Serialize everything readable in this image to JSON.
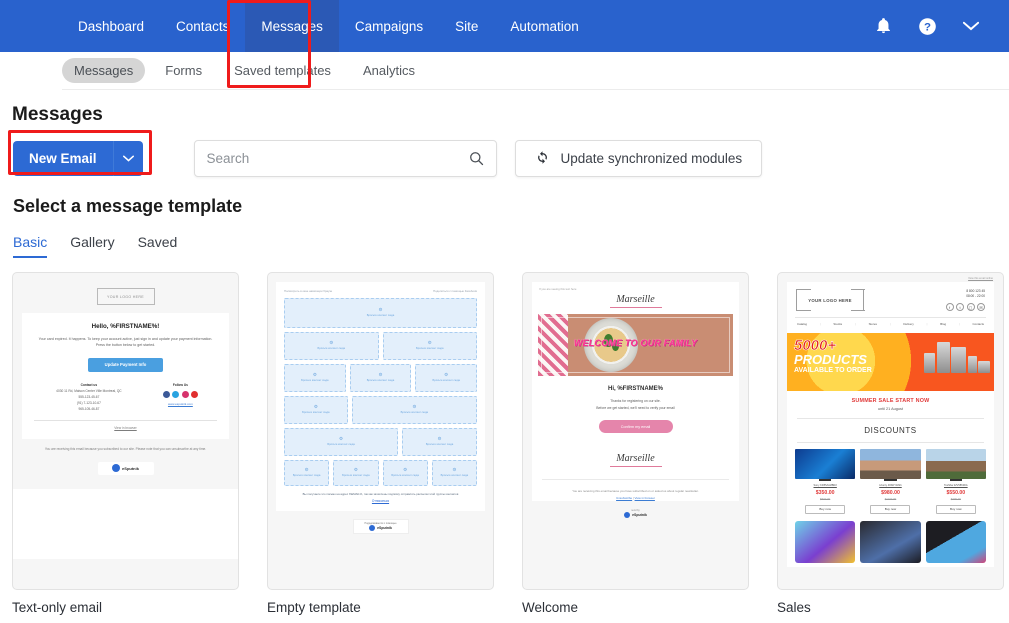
{
  "topnav": {
    "items": [
      {
        "label": "Dashboard",
        "active": false
      },
      {
        "label": "Contacts",
        "active": false
      },
      {
        "label": "Messages",
        "active": true
      },
      {
        "label": "Campaigns",
        "active": false
      },
      {
        "label": "Site",
        "active": false
      },
      {
        "label": "Automation",
        "active": false
      }
    ],
    "icons": [
      "bell-icon",
      "help-icon",
      "chevron-down-icon"
    ],
    "accent_color": "#2962cd",
    "active_color": "#2b59b5"
  },
  "subnav": {
    "items": [
      {
        "label": "Messages",
        "active": true
      },
      {
        "label": "Forms",
        "active": false
      },
      {
        "label": "Saved templates",
        "active": false
      },
      {
        "label": "Analytics",
        "active": false
      }
    ]
  },
  "annotations": {
    "color": "#ef1b1b",
    "boxes": [
      "messages-nav-highlight",
      "new-email-button-highlight"
    ]
  },
  "page": {
    "title": "Messages",
    "section_title": "Select a message template"
  },
  "toolbar": {
    "new_email_label": "New Email",
    "new_email_caret": "⌄",
    "search_placeholder": "Search",
    "search_value": "",
    "update_label": "Update synchronized modules",
    "button_color": "#2d6ad4"
  },
  "tabs": [
    {
      "label": "Basic",
      "active": true
    },
    {
      "label": "Gallery",
      "active": false
    },
    {
      "label": "Saved",
      "active": false
    }
  ],
  "templates": [
    {
      "label": "Text-only email",
      "preview": {
        "logo": "YOUR LOGO HERE",
        "heading": "Hello, %FIRSTNAME%!",
        "paragraph": "Your card expired. It happens. To keep your account active, just sign in and update your payment information. Press the button below to get started.",
        "button": "Update Payment Info",
        "contact_label": "Contact us",
        "contact_address": "4030 11 Rd, Maison Center Ville Montreal, QC",
        "contact_phones": [
          "555-123-45-67",
          "(91) 7-123-10-67",
          "965-105-46-87"
        ],
        "follow_label": "Follow Us",
        "follow_link": "www.esputnik.com",
        "view_in_browser": "View in browser",
        "footer": "You are receiving this email because you subscribed to our site. Please note that you can unsubscribe at any time.",
        "footer_link": "unsubscribe",
        "badge_pre": "send by",
        "badge": "eSputnik"
      }
    },
    {
      "label": "Empty template",
      "preview": {
        "top_left": "Посмотреть в окне навигации браузе",
        "top_right": "Поделиться с помощью Facebook",
        "dropzone_label": "Бросьте контент сюда",
        "rows": [
          [
            1
          ],
          [
            1,
            1
          ],
          [
            1,
            1,
            1
          ],
          [
            1,
            2
          ],
          [
            2,
            1
          ],
          [
            1,
            1,
            1,
            1
          ]
        ],
        "footer": "Вы получаете это письмо на адрес %EMAIL%, так как зачислены подписку отправлять рассылки этой группы контактов",
        "unsubscribe": "Отписаться",
        "badge_pre": "Поддерживается с помощью",
        "badge": "eSputnik"
      }
    },
    {
      "label": "Welcome",
      "preview": {
        "preheader": "If you are seeing this text here",
        "brand": "Marseille",
        "hero_text": "WELCOME TO OUR FAMILY",
        "heading": "Hi, %FIRSTNAME%",
        "paragraph_1": "Thanks for registering on our site.",
        "paragraph_2": "Before we get started, we'll need to verify your email",
        "button": "Confirm my email",
        "brand_footer": "Marseille",
        "footer": "You are receiving this email because you have subscribed on or asked us about regular newsletter.",
        "footer_links": [
          "Unsubscribe",
          "View in browser"
        ],
        "badge_pre": "send by",
        "badge": "eSputnik"
      }
    },
    {
      "label": "Sales",
      "preview": {
        "top_link": "View this email online",
        "logo": "YOUR LOGO HERE",
        "phone": "8 800 123 45",
        "hours": "08:00 - 22:00",
        "menu": [
          "Catalog",
          "Stocks",
          "Stores",
          "Delivery",
          "Blog",
          "Contacts"
        ],
        "banner_line_1": "5000+",
        "banner_line_2": "PRODUCTS",
        "banner_line_3": "AVAILABLE TO ORDER",
        "sale_title": "SUMMER SALE START NOW",
        "sale_until": "until 21 August",
        "discounts_title": "DISCOUNTS",
        "products": [
          {
            "name": "Sony KD55AG8BR2",
            "price": "$350.00",
            "old_price": "$500.00",
            "button": "Buy now"
          },
          {
            "name": "Liberty 49SDY1821",
            "price": "$980.00",
            "old_price": "$1100.00",
            "button": "Buy now"
          },
          {
            "name": "Toshiba 32V5863DA",
            "price": "$550.00",
            "old_price": "$700.00",
            "button": "Buy now"
          }
        ]
      }
    }
  ]
}
